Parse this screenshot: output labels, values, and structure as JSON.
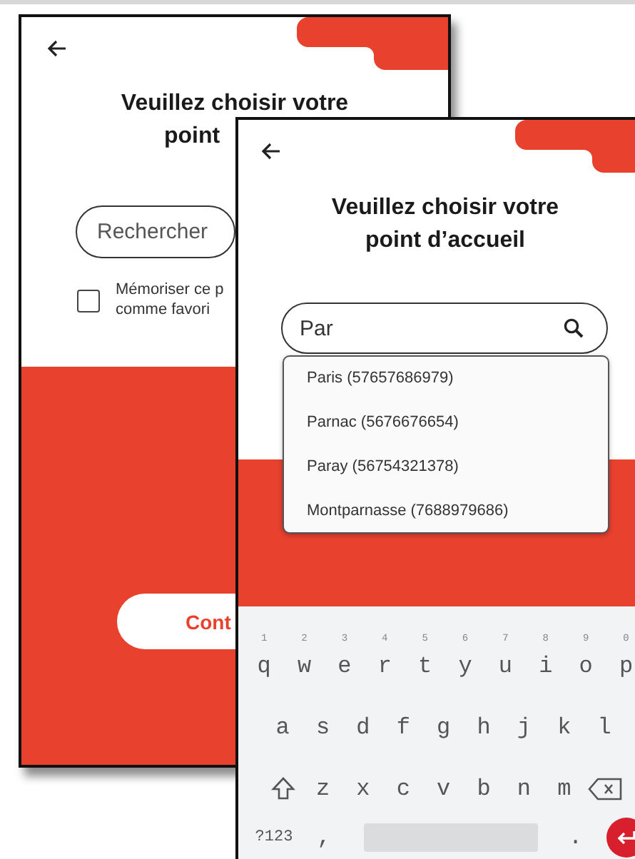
{
  "back_screen": {
    "title_lines": [
      "Veuillez choisir votre",
      "point"
    ],
    "search": {
      "placeholder": "Rechercher"
    },
    "favorite": {
      "label_lines": [
        "Mémoriser ce p",
        "comme favori"
      ],
      "checked": false
    },
    "button": "Cont"
  },
  "front_screen": {
    "title_lines": [
      "Veuillez choisir votre",
      "point d’accueil"
    ],
    "search": {
      "value": "Par"
    },
    "suggestions": [
      "Paris (57657686979)",
      "Parnac (5676676654)",
      "Paray (56754321378)",
      "Montparnasse (7688979686)"
    ],
    "keyboard": {
      "rows": [
        [
          {
            "kind": "char",
            "label": "q",
            "hint": "1"
          },
          {
            "kind": "char",
            "label": "w",
            "hint": "2"
          },
          {
            "kind": "char",
            "label": "e",
            "hint": "3"
          },
          {
            "kind": "char",
            "label": "r",
            "hint": "4"
          },
          {
            "kind": "char",
            "label": "t",
            "hint": "5"
          },
          {
            "kind": "char",
            "label": "y",
            "hint": "6"
          },
          {
            "kind": "char",
            "label": "u",
            "hint": "7"
          },
          {
            "kind": "char",
            "label": "i",
            "hint": "8"
          },
          {
            "kind": "char",
            "label": "o",
            "hint": "9"
          },
          {
            "kind": "char",
            "label": "p",
            "hint": "0"
          }
        ],
        [
          {
            "kind": "char",
            "label": "a"
          },
          {
            "kind": "char",
            "label": "s"
          },
          {
            "kind": "char",
            "label": "d"
          },
          {
            "kind": "char",
            "label": "f"
          },
          {
            "kind": "char",
            "label": "g"
          },
          {
            "kind": "char",
            "label": "h"
          },
          {
            "kind": "char",
            "label": "j"
          },
          {
            "kind": "char",
            "label": "k"
          },
          {
            "kind": "char",
            "label": "l"
          }
        ],
        [
          {
            "kind": "shift"
          },
          {
            "kind": "char",
            "label": "z"
          },
          {
            "kind": "char",
            "label": "x"
          },
          {
            "kind": "char",
            "label": "c"
          },
          {
            "kind": "char",
            "label": "v"
          },
          {
            "kind": "char",
            "label": "b"
          },
          {
            "kind": "char",
            "label": "n"
          },
          {
            "kind": "char",
            "label": "m"
          },
          {
            "kind": "backspace"
          }
        ],
        [
          {
            "kind": "symbols",
            "label": "?123"
          },
          {
            "kind": "char",
            "label": ","
          },
          {
            "kind": "space"
          },
          {
            "kind": "char",
            "label": "."
          },
          {
            "kind": "enter"
          }
        ]
      ]
    }
  }
}
